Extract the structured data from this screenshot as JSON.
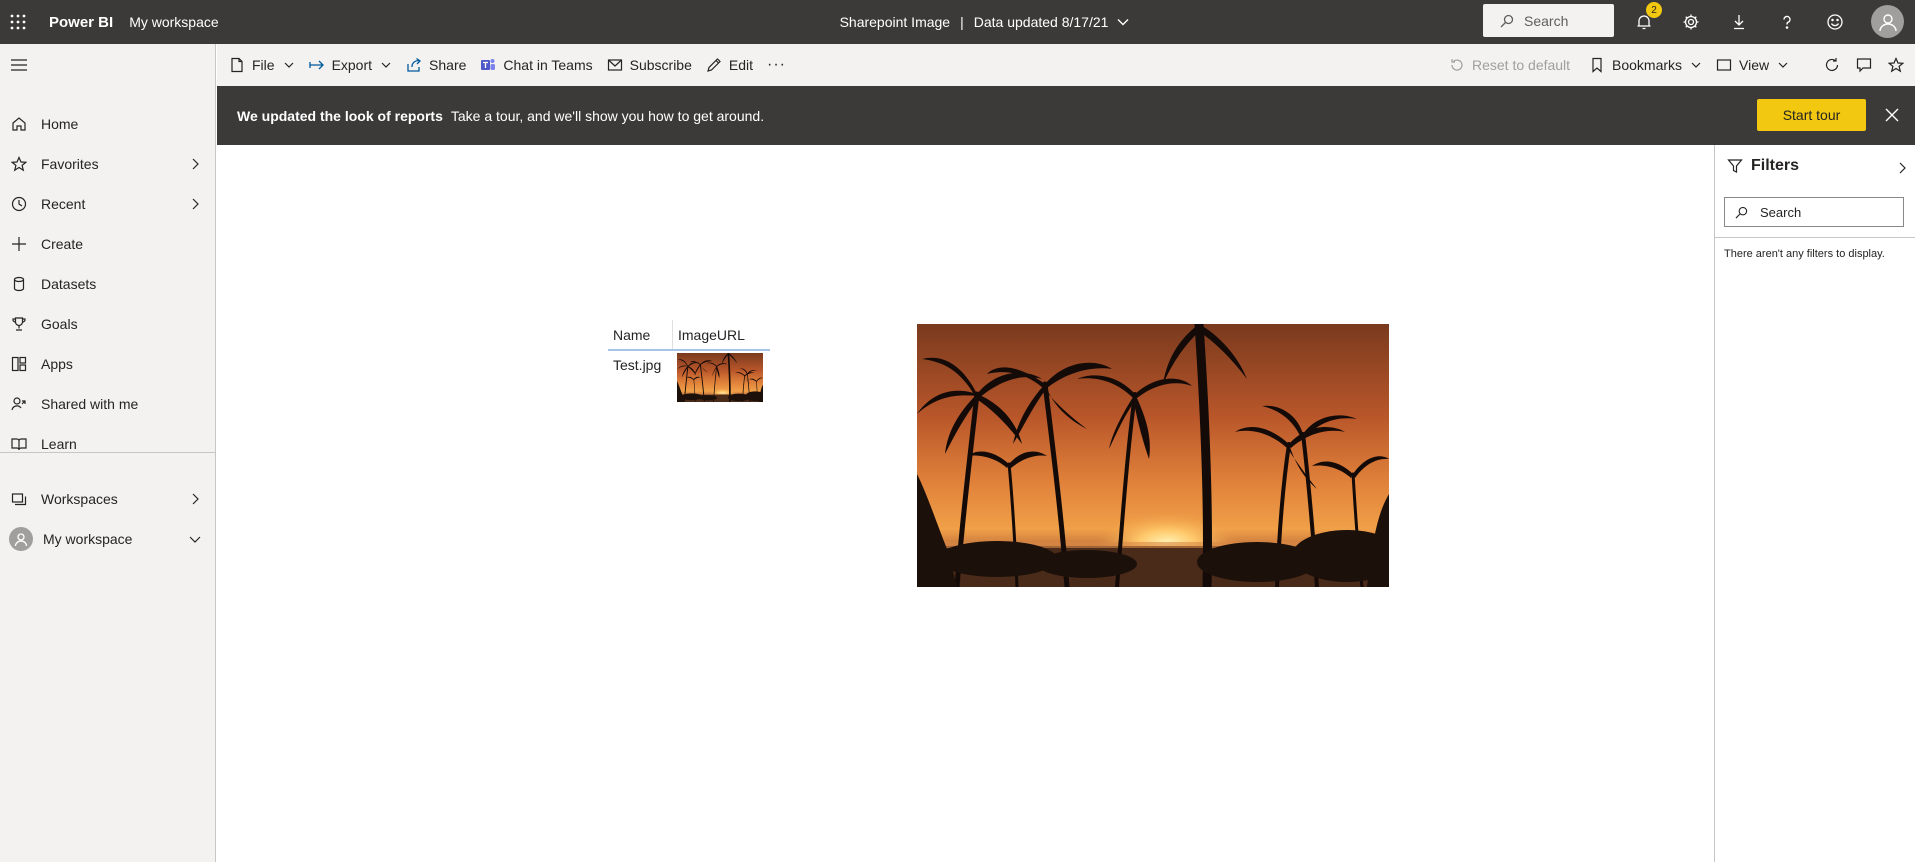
{
  "topbar": {
    "brand": "Power BI",
    "workspace": "My workspace",
    "report_title": "Sharepoint Image",
    "separator": "|",
    "data_updated": "Data updated 8/17/21",
    "search_placeholder": "Search",
    "notification_count": "2"
  },
  "sidebar": {
    "items": [
      {
        "label": "Home",
        "icon": "home-icon"
      },
      {
        "label": "Favorites",
        "icon": "star-icon"
      },
      {
        "label": "Recent",
        "icon": "clock-icon"
      },
      {
        "label": "Create",
        "icon": "plus-icon"
      },
      {
        "label": "Datasets",
        "icon": "database-icon"
      },
      {
        "label": "Goals",
        "icon": "trophy-icon"
      },
      {
        "label": "Apps",
        "icon": "apps-icon"
      },
      {
        "label": "Shared with me",
        "icon": "shared-icon"
      },
      {
        "label": "Learn",
        "icon": "book-icon"
      }
    ],
    "workspaces": "Workspaces",
    "my_workspace": "My workspace"
  },
  "actions": {
    "file": "File",
    "export": "Export",
    "share": "Share",
    "chat_in_teams": "Chat in Teams",
    "subscribe": "Subscribe",
    "edit": "Edit",
    "more": "···",
    "reset": "Reset to default",
    "bookmarks": "Bookmarks",
    "view": "View"
  },
  "banner": {
    "title": "We updated the look of reports",
    "message": "Take a tour, and we'll show you how to get around.",
    "start_tour": "Start tour"
  },
  "table": {
    "columns": [
      "Name",
      "ImageURL"
    ],
    "rows": [
      {
        "name": "Test.jpg"
      }
    ]
  },
  "filters": {
    "title": "Filters",
    "search_placeholder": "Search",
    "empty_message": "There aren't any filters to display."
  },
  "colors": {
    "topbar_bg": "#3b3a39",
    "accent_yellow": "#f2c811",
    "sidebar_bg": "#f3f2f1"
  }
}
